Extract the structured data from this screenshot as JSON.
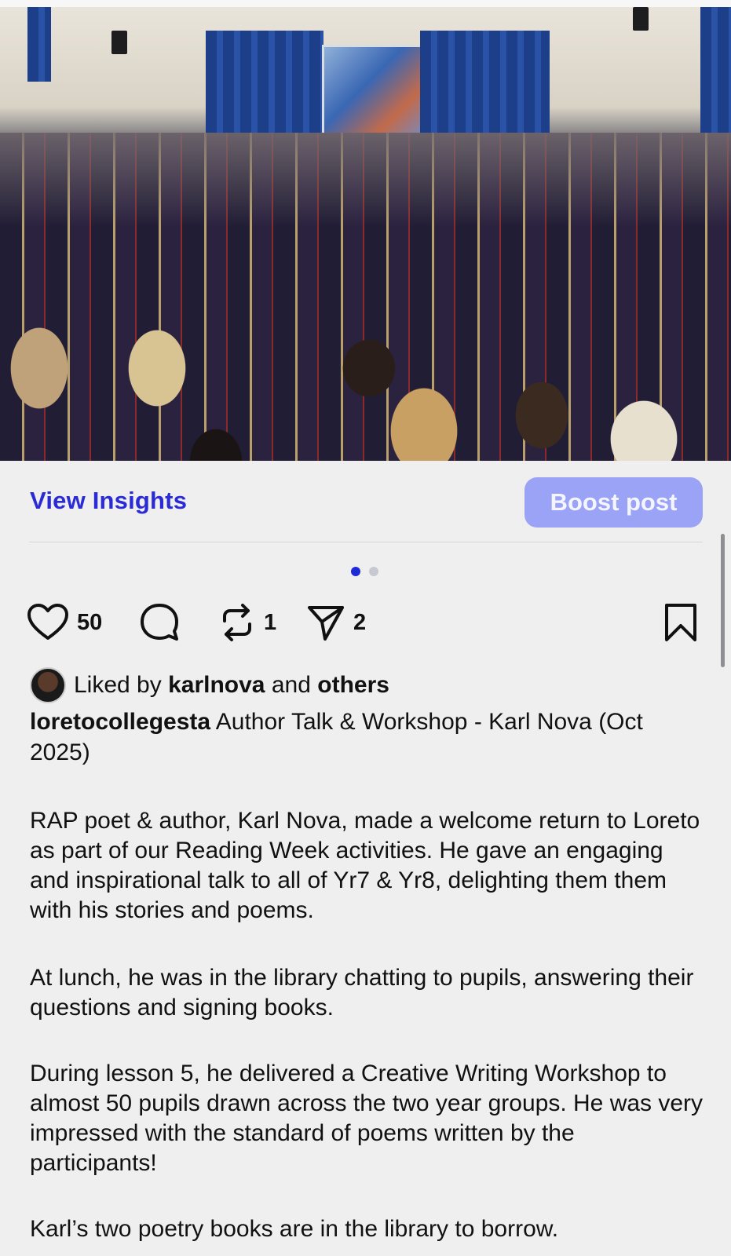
{
  "post": {
    "photo_alt": "photo",
    "view_insights": "View Insights",
    "boost_post": "Boost post",
    "carousel": {
      "total": 2,
      "active_index": 0
    },
    "actions": {
      "likes": "50",
      "reposts": "1",
      "shares": "2"
    },
    "liked_by": {
      "prefix": "Liked by",
      "user": "karlnova",
      "and": "and",
      "others": "others"
    },
    "author": "loretocollegesta",
    "caption_title": "Author Talk & Workshop - Karl Nova (Oct 2025)",
    "paragraphs": [
      "RAP poet & author, Karl Nova, made a welcome return to Loreto as part of our Reading Week activities. He gave an engaging and inspirational talk to all of Yr7 & Yr8, delighting them them with his stories and poems.",
      "At lunch, he was in the library chatting to pupils, answering their questions and signing books.",
      "During lesson 5, he delivered a Creative Writing Workshop to almost 50 pupils drawn across the two year groups. He was very impressed with the standard of poems written by the participants!",
      "Karl’s two poetry books are in the library to borrow."
    ],
    "colors": {
      "accent": "#2a2bd4",
      "boost_bg": "#9aa3f6",
      "background": "#efefef"
    },
    "icons": [
      "heart-icon",
      "comment-icon",
      "repost-icon",
      "share-icon",
      "bookmark-icon"
    ]
  }
}
